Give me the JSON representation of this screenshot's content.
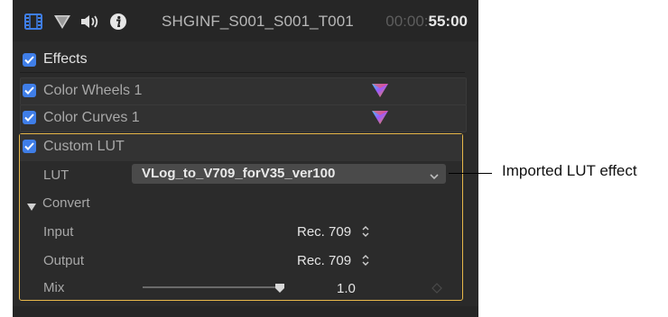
{
  "header": {
    "icons": [
      "film-icon",
      "color-triangle-icon",
      "speaker-icon",
      "info-icon"
    ],
    "clip_name": "SHGINF_S001_S001_T001",
    "timecode_dim": "00:00:",
    "timecode_bright": "55:00"
  },
  "effects": {
    "label": "Effects",
    "checked": true,
    "items": [
      {
        "label": "Color Wheels 1",
        "checked": true,
        "icon": "color-triangle-icon"
      },
      {
        "label": "Color Curves 1",
        "checked": true,
        "icon": "color-triangle-icon"
      }
    ],
    "custom_lut": {
      "label": "Custom LUT",
      "checked": true,
      "lut_label": "LUT",
      "lut_value": "VLog_to_V709_forV35_ver100",
      "convert_label": "Convert",
      "input_label": "Input",
      "input_value": "Rec. 709",
      "output_label": "Output",
      "output_value": "Rec. 709",
      "mix_label": "Mix",
      "mix_value": "1.0",
      "mix_level": 1.0
    }
  },
  "callout": {
    "text": "Imported LUT effect"
  },
  "colors": {
    "accent": "#3f7ee8",
    "highlight_border": "#e8b84a",
    "panel_bg": "#2a2a2a"
  }
}
